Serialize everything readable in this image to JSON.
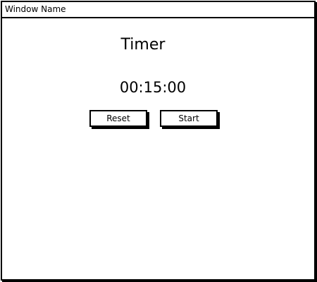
{
  "window": {
    "title": "Window Name"
  },
  "timer": {
    "heading": "Timer",
    "display": "00:15:00"
  },
  "buttons": {
    "reset_label": "Reset",
    "start_label": "Start"
  }
}
